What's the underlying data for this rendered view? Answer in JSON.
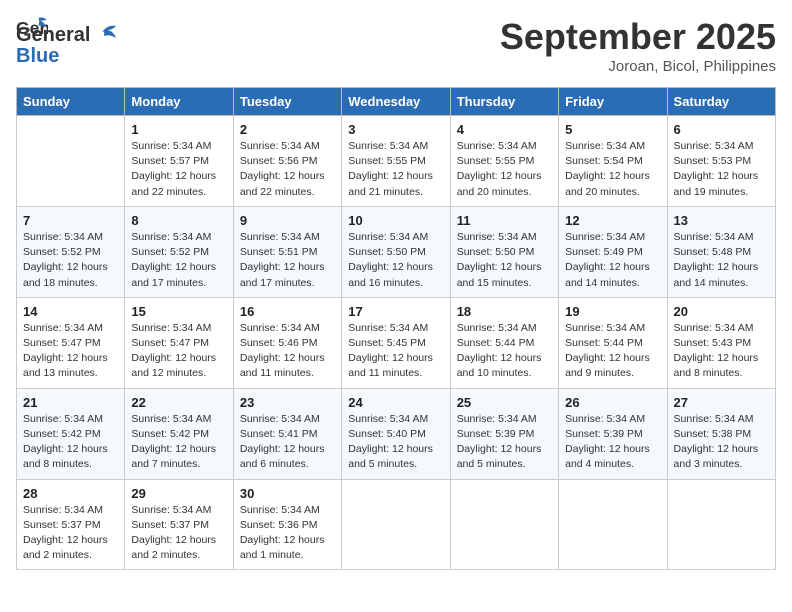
{
  "header": {
    "logo_line1": "General",
    "logo_line2": "Blue",
    "month": "September 2025",
    "location": "Joroan, Bicol, Philippines"
  },
  "days_of_week": [
    "Sunday",
    "Monday",
    "Tuesday",
    "Wednesday",
    "Thursday",
    "Friday",
    "Saturday"
  ],
  "weeks": [
    [
      {
        "day": "",
        "info": ""
      },
      {
        "day": "1",
        "info": "Sunrise: 5:34 AM\nSunset: 5:57 PM\nDaylight: 12 hours\nand 22 minutes."
      },
      {
        "day": "2",
        "info": "Sunrise: 5:34 AM\nSunset: 5:56 PM\nDaylight: 12 hours\nand 22 minutes."
      },
      {
        "day": "3",
        "info": "Sunrise: 5:34 AM\nSunset: 5:55 PM\nDaylight: 12 hours\nand 21 minutes."
      },
      {
        "day": "4",
        "info": "Sunrise: 5:34 AM\nSunset: 5:55 PM\nDaylight: 12 hours\nand 20 minutes."
      },
      {
        "day": "5",
        "info": "Sunrise: 5:34 AM\nSunset: 5:54 PM\nDaylight: 12 hours\nand 20 minutes."
      },
      {
        "day": "6",
        "info": "Sunrise: 5:34 AM\nSunset: 5:53 PM\nDaylight: 12 hours\nand 19 minutes."
      }
    ],
    [
      {
        "day": "7",
        "info": "Sunrise: 5:34 AM\nSunset: 5:52 PM\nDaylight: 12 hours\nand 18 minutes."
      },
      {
        "day": "8",
        "info": "Sunrise: 5:34 AM\nSunset: 5:52 PM\nDaylight: 12 hours\nand 17 minutes."
      },
      {
        "day": "9",
        "info": "Sunrise: 5:34 AM\nSunset: 5:51 PM\nDaylight: 12 hours\nand 17 minutes."
      },
      {
        "day": "10",
        "info": "Sunrise: 5:34 AM\nSunset: 5:50 PM\nDaylight: 12 hours\nand 16 minutes."
      },
      {
        "day": "11",
        "info": "Sunrise: 5:34 AM\nSunset: 5:50 PM\nDaylight: 12 hours\nand 15 minutes."
      },
      {
        "day": "12",
        "info": "Sunrise: 5:34 AM\nSunset: 5:49 PM\nDaylight: 12 hours\nand 14 minutes."
      },
      {
        "day": "13",
        "info": "Sunrise: 5:34 AM\nSunset: 5:48 PM\nDaylight: 12 hours\nand 14 minutes."
      }
    ],
    [
      {
        "day": "14",
        "info": "Sunrise: 5:34 AM\nSunset: 5:47 PM\nDaylight: 12 hours\nand 13 minutes."
      },
      {
        "day": "15",
        "info": "Sunrise: 5:34 AM\nSunset: 5:47 PM\nDaylight: 12 hours\nand 12 minutes."
      },
      {
        "day": "16",
        "info": "Sunrise: 5:34 AM\nSunset: 5:46 PM\nDaylight: 12 hours\nand 11 minutes."
      },
      {
        "day": "17",
        "info": "Sunrise: 5:34 AM\nSunset: 5:45 PM\nDaylight: 12 hours\nand 11 minutes."
      },
      {
        "day": "18",
        "info": "Sunrise: 5:34 AM\nSunset: 5:44 PM\nDaylight: 12 hours\nand 10 minutes."
      },
      {
        "day": "19",
        "info": "Sunrise: 5:34 AM\nSunset: 5:44 PM\nDaylight: 12 hours\nand 9 minutes."
      },
      {
        "day": "20",
        "info": "Sunrise: 5:34 AM\nSunset: 5:43 PM\nDaylight: 12 hours\nand 8 minutes."
      }
    ],
    [
      {
        "day": "21",
        "info": "Sunrise: 5:34 AM\nSunset: 5:42 PM\nDaylight: 12 hours\nand 8 minutes."
      },
      {
        "day": "22",
        "info": "Sunrise: 5:34 AM\nSunset: 5:42 PM\nDaylight: 12 hours\nand 7 minutes."
      },
      {
        "day": "23",
        "info": "Sunrise: 5:34 AM\nSunset: 5:41 PM\nDaylight: 12 hours\nand 6 minutes."
      },
      {
        "day": "24",
        "info": "Sunrise: 5:34 AM\nSunset: 5:40 PM\nDaylight: 12 hours\nand 5 minutes."
      },
      {
        "day": "25",
        "info": "Sunrise: 5:34 AM\nSunset: 5:39 PM\nDaylight: 12 hours\nand 5 minutes."
      },
      {
        "day": "26",
        "info": "Sunrise: 5:34 AM\nSunset: 5:39 PM\nDaylight: 12 hours\nand 4 minutes."
      },
      {
        "day": "27",
        "info": "Sunrise: 5:34 AM\nSunset: 5:38 PM\nDaylight: 12 hours\nand 3 minutes."
      }
    ],
    [
      {
        "day": "28",
        "info": "Sunrise: 5:34 AM\nSunset: 5:37 PM\nDaylight: 12 hours\nand 2 minutes."
      },
      {
        "day": "29",
        "info": "Sunrise: 5:34 AM\nSunset: 5:37 PM\nDaylight: 12 hours\nand 2 minutes."
      },
      {
        "day": "30",
        "info": "Sunrise: 5:34 AM\nSunset: 5:36 PM\nDaylight: 12 hours\nand 1 minute."
      },
      {
        "day": "",
        "info": ""
      },
      {
        "day": "",
        "info": ""
      },
      {
        "day": "",
        "info": ""
      },
      {
        "day": "",
        "info": ""
      }
    ]
  ]
}
